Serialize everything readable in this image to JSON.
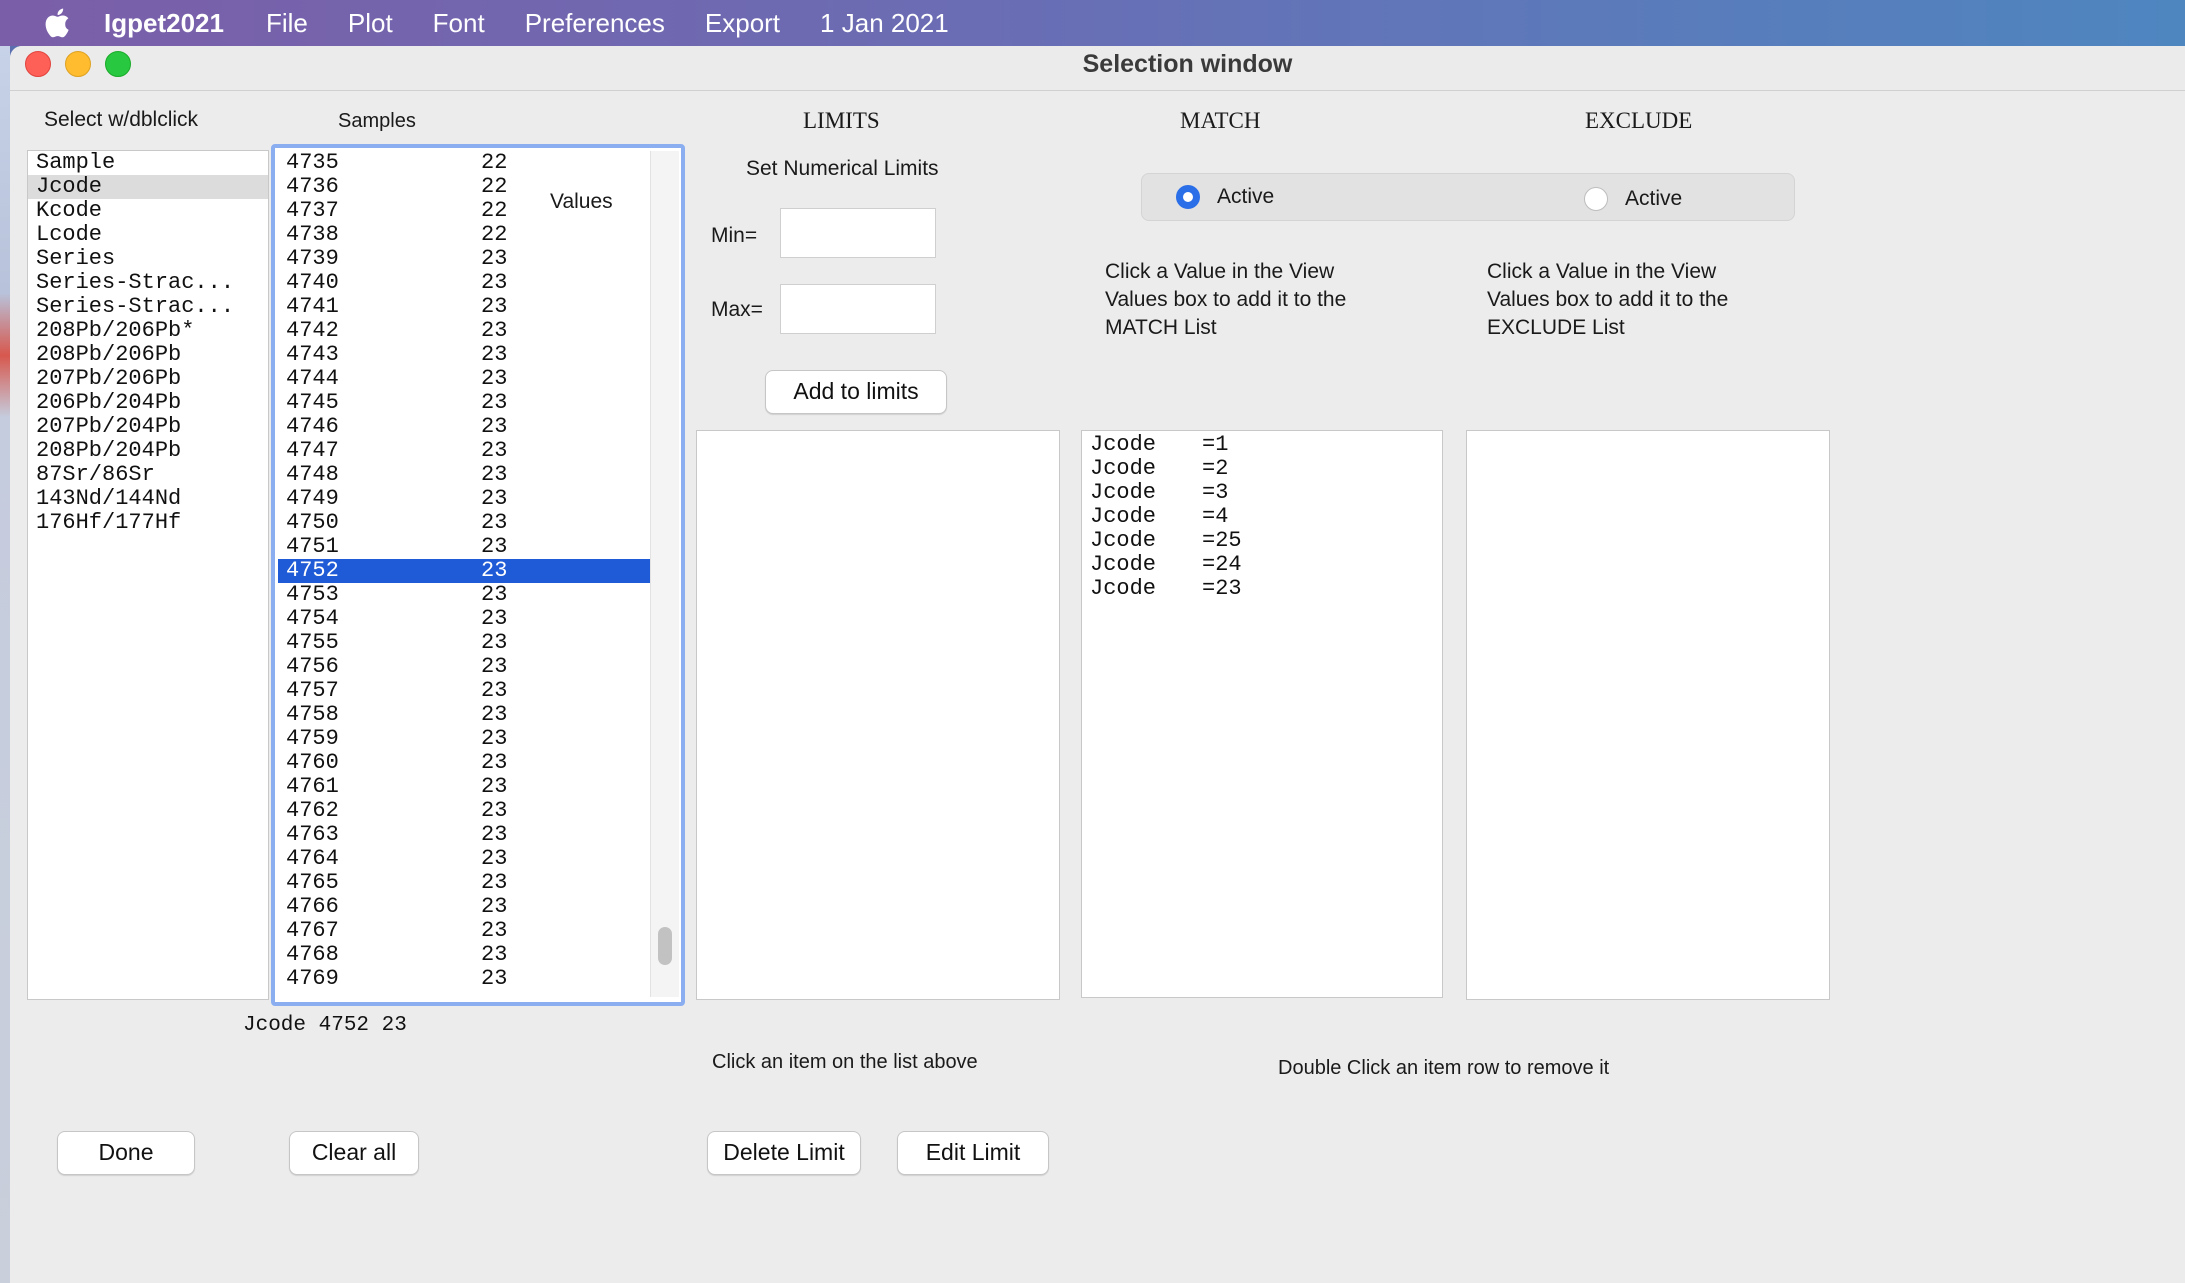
{
  "menubar": {
    "app_name": "Igpet2021",
    "items": [
      "File",
      "Plot",
      "Font",
      "Preferences",
      "Export"
    ],
    "date": "1 Jan 2021"
  },
  "window": {
    "title": "Selection window"
  },
  "select_column": {
    "header": "Select w/dblclick",
    "items": [
      "Sample",
      "Jcode",
      "Kcode",
      "Lcode",
      "Series",
      "Series-Strac...",
      "Series-Strac...",
      "208Pb/206Pb*",
      "208Pb/206Pb",
      "207Pb/206Pb",
      "206Pb/204Pb",
      "207Pb/204Pb",
      "208Pb/204Pb",
      "87Sr/86Sr",
      "143Nd/144Nd",
      "176Hf/177Hf"
    ],
    "selected_index": 1
  },
  "samples_column": {
    "header": "Samples",
    "values_label": "Values",
    "rows": [
      [
        "4735",
        "22"
      ],
      [
        "4736",
        "22"
      ],
      [
        "4737",
        "22"
      ],
      [
        "4738",
        "22"
      ],
      [
        "4739",
        "23"
      ],
      [
        "4740",
        "23"
      ],
      [
        "4741",
        "23"
      ],
      [
        "4742",
        "23"
      ],
      [
        "4743",
        "23"
      ],
      [
        "4744",
        "23"
      ],
      [
        "4745",
        "23"
      ],
      [
        "4746",
        "23"
      ],
      [
        "4747",
        "23"
      ],
      [
        "4748",
        "23"
      ],
      [
        "4749",
        "23"
      ],
      [
        "4750",
        "23"
      ],
      [
        "4751",
        "23"
      ],
      [
        "4752",
        "23"
      ],
      [
        "4753",
        "23"
      ],
      [
        "4754",
        "23"
      ],
      [
        "4755",
        "23"
      ],
      [
        "4756",
        "23"
      ],
      [
        "4757",
        "23"
      ],
      [
        "4758",
        "23"
      ],
      [
        "4759",
        "23"
      ],
      [
        "4760",
        "23"
      ],
      [
        "4761",
        "23"
      ],
      [
        "4762",
        "23"
      ],
      [
        "4763",
        "23"
      ],
      [
        "4764",
        "23"
      ],
      [
        "4765",
        "23"
      ],
      [
        "4766",
        "23"
      ],
      [
        "4767",
        "23"
      ],
      [
        "4768",
        "23"
      ],
      [
        "4769",
        "23"
      ]
    ],
    "selected_sample": "4752",
    "status_text": "Jcode 4752    23"
  },
  "limits": {
    "header": "LIMITS",
    "subheader": "Set Numerical Limits",
    "min_label": "Min=",
    "max_label": "Max=",
    "min_value": "",
    "max_value": "",
    "add_button": "Add to limits",
    "hint": "Click an item on the list above",
    "delete_button": "Delete Limit",
    "edit_button": "Edit Limit"
  },
  "match": {
    "header": "MATCH",
    "active_label": "Active",
    "active": true,
    "help": [
      "Click a Value in the View",
      "Values box to add it to the",
      "MATCH List"
    ],
    "entries": [
      [
        "Jcode",
        "=1"
      ],
      [
        "Jcode",
        "=2"
      ],
      [
        "Jcode",
        "=3"
      ],
      [
        "Jcode",
        "=4"
      ],
      [
        "Jcode",
        "=25"
      ],
      [
        "Jcode",
        "=24"
      ],
      [
        "Jcode",
        "=23"
      ]
    ]
  },
  "exclude": {
    "header": "EXCLUDE",
    "active_label": "Active",
    "active": false,
    "help": [
      "Click a Value in the View",
      "Values box to add  it to the",
      "EXCLUDE List"
    ]
  },
  "remove_hint": "Double Click an item row to remove it",
  "buttons": {
    "done": "Done",
    "clear_all": "Clear all"
  },
  "colors": {
    "selection_blue": "#1f5bd6",
    "focus_ring": "#8aaef0",
    "radio_active": "#2a6ee8"
  }
}
